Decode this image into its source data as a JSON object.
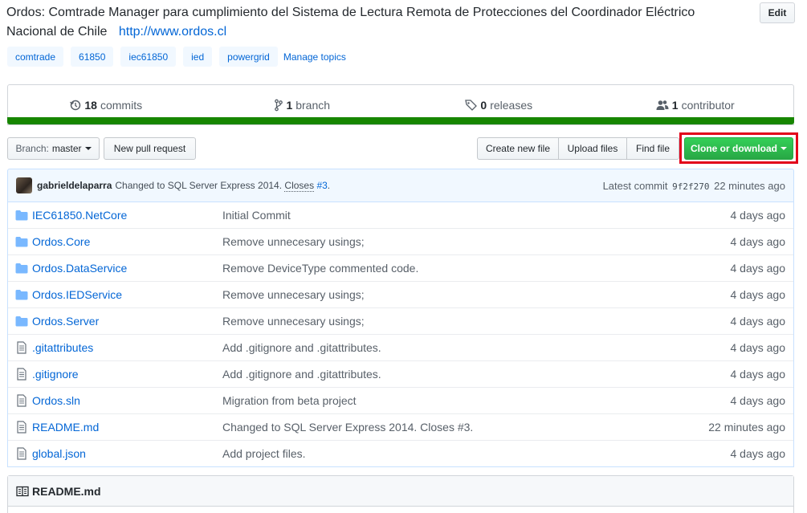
{
  "repo": {
    "description": "Ordos: Comtrade Manager para cumplimiento del Sistema de Lectura Remota de Protecciones del Coordinador Eléctrico Nacional de Chile",
    "homepage": "http://www.ordos.cl",
    "edit_label": "Edit"
  },
  "topics": [
    "comtrade",
    "61850",
    "iec61850",
    "ied",
    "powergrid"
  ],
  "manage_topics_label": "Manage topics",
  "numbers": {
    "commits": {
      "count": "18",
      "label": "commits",
      "icon": "history-icon"
    },
    "branch": {
      "count": "1",
      "label": "branch",
      "icon": "git-branch-icon"
    },
    "releases": {
      "count": "0",
      "label": "releases",
      "icon": "tag-icon"
    },
    "contributor": {
      "count": "1",
      "label": "contributor",
      "icon": "people-icon"
    }
  },
  "language_color": "#178600",
  "toolbar": {
    "branch_prefix": "Branch:",
    "branch_name": "master",
    "new_pr": "New pull request",
    "create_file": "Create new file",
    "upload_files": "Upload files",
    "find_file": "Find file",
    "clone": "Clone or download"
  },
  "latest_commit": {
    "author": "gabrieldelaparra",
    "message": "Changed to SQL Server Express 2014.",
    "closes": "Closes",
    "issue": "#3",
    "prefix": "Latest commit",
    "sha": "9f2f270",
    "age": "22 minutes ago"
  },
  "files": [
    {
      "type": "dir",
      "name": "IEC61850.NetCore",
      "message": "Initial Commit",
      "age": "4 days ago"
    },
    {
      "type": "dir",
      "name": "Ordos.Core",
      "message": "Remove unnecesary usings;",
      "age": "4 days ago"
    },
    {
      "type": "dir",
      "name": "Ordos.DataService",
      "message": "Remove DeviceType commented code.",
      "age": "4 days ago"
    },
    {
      "type": "dir",
      "name": "Ordos.IEDService",
      "message": "Remove unnecesary usings;",
      "age": "4 days ago"
    },
    {
      "type": "dir",
      "name": "Ordos.Server",
      "message": "Remove unnecesary usings;",
      "age": "4 days ago"
    },
    {
      "type": "file",
      "name": ".gitattributes",
      "message": "Add .gitignore and .gitattributes.",
      "age": "4 days ago"
    },
    {
      "type": "file",
      "name": ".gitignore",
      "message": "Add .gitignore and .gitattributes.",
      "age": "4 days ago"
    },
    {
      "type": "file",
      "name": "Ordos.sln",
      "message": "Migration from beta project",
      "age": "4 days ago"
    },
    {
      "type": "file",
      "name": "README.md",
      "message": "Changed to SQL Server Express 2014. Closes #3.",
      "age": "22 minutes ago"
    },
    {
      "type": "file",
      "name": "global.json",
      "message": "Add project files.",
      "age": "4 days ago"
    }
  ],
  "readme": {
    "title": "README.md"
  }
}
